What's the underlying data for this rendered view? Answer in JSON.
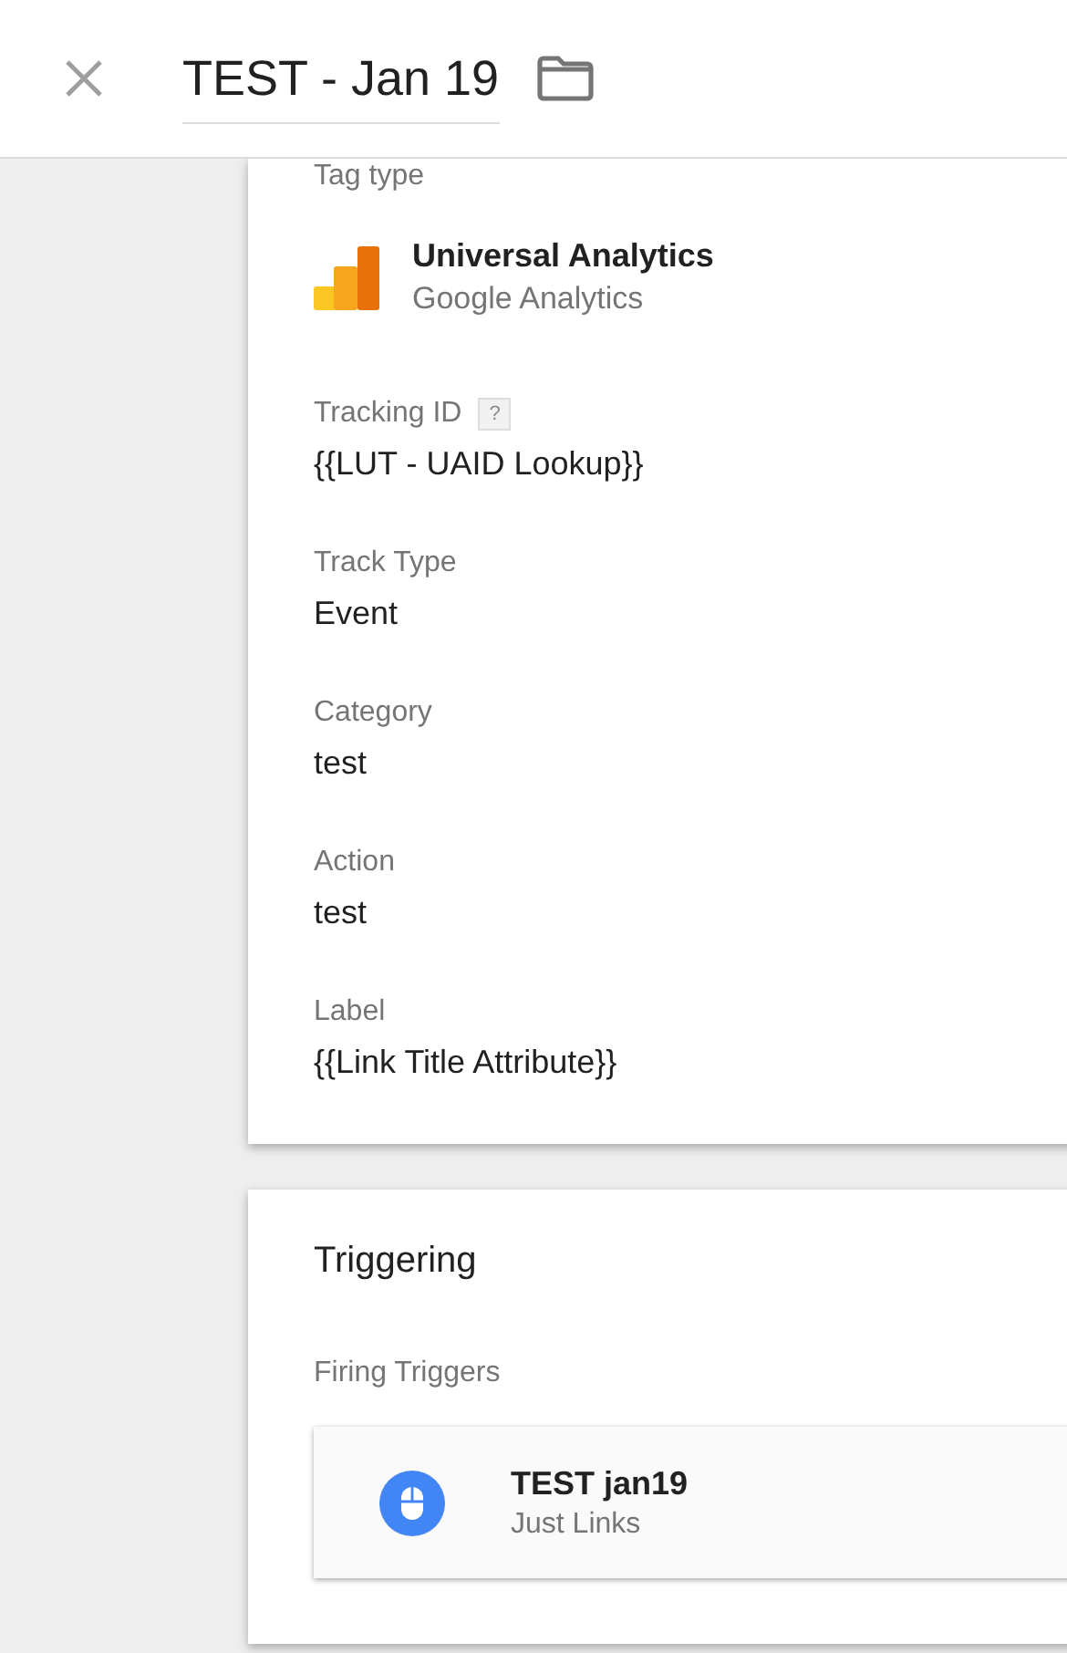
{
  "header": {
    "title": "TEST - Jan 19"
  },
  "tag_config": {
    "section_label": "Tag type",
    "tag_name": "Universal Analytics",
    "tag_vendor": "Google Analytics",
    "fields": [
      {
        "label": "Tracking ID",
        "value": "{{LUT - UAID Lookup}}",
        "help": "?"
      },
      {
        "label": "Track Type",
        "value": "Event"
      },
      {
        "label": "Category",
        "value": "test"
      },
      {
        "label": "Action",
        "value": "test"
      },
      {
        "label": "Label",
        "value": "{{Link Title Attribute}}"
      }
    ]
  },
  "triggering": {
    "title": "Triggering",
    "subtitle": "Firing Triggers",
    "triggers": [
      {
        "name": "TEST jan19",
        "type": "Just Links"
      }
    ]
  }
}
